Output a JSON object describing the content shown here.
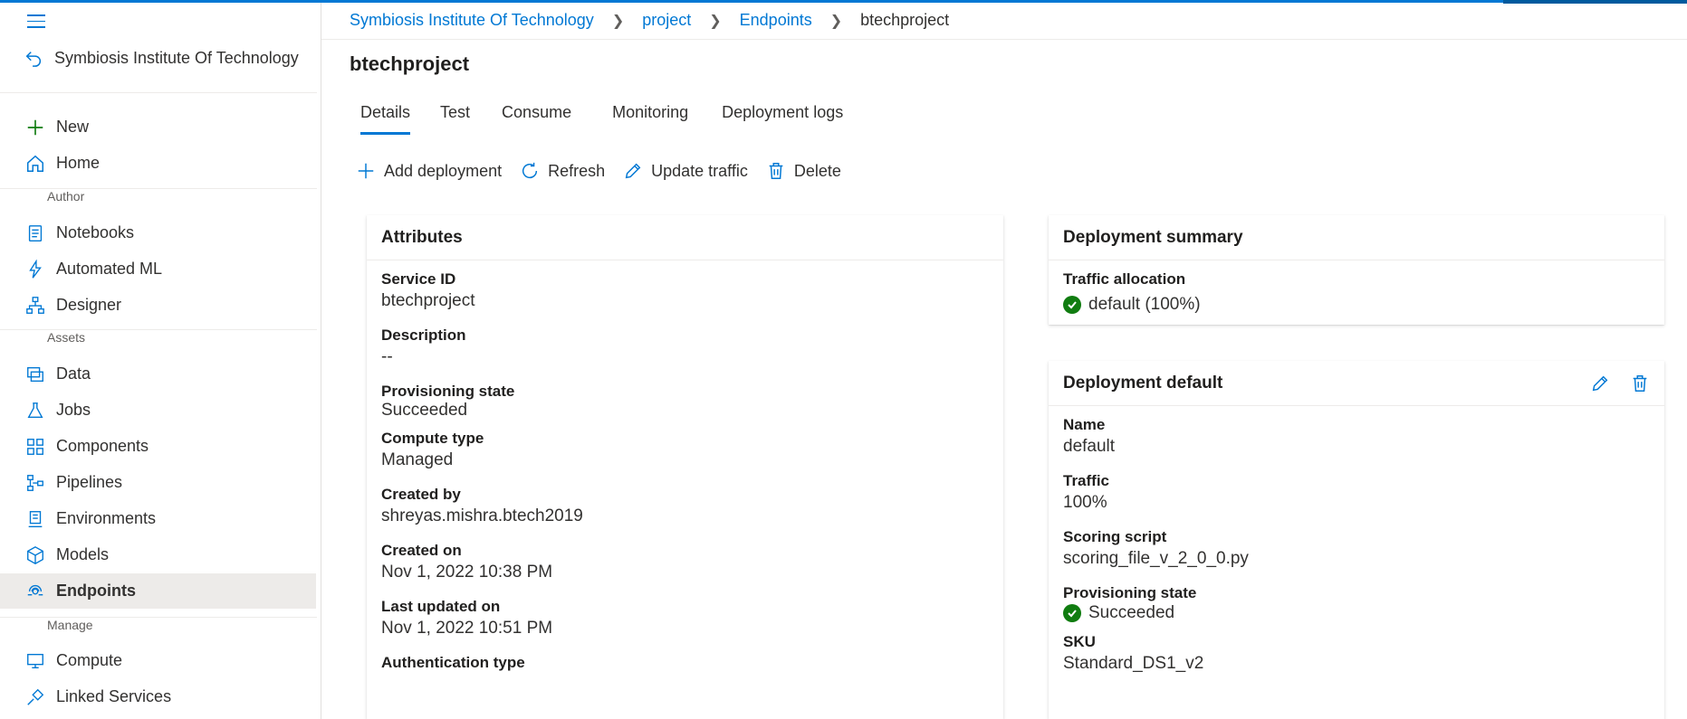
{
  "colors": {
    "accent": "#0078d4",
    "success": "#107c10",
    "active_bg": "#edebe9"
  },
  "workspace": {
    "name": "Symbiosis Institute Of Technology"
  },
  "sidebar": {
    "new_label": "New",
    "home_label": "Home",
    "sections": {
      "author": "Author",
      "assets": "Assets",
      "manage": "Manage"
    },
    "author_items": [
      {
        "label": "Notebooks",
        "icon": "notebook-icon"
      },
      {
        "label": "Automated ML",
        "icon": "automl-icon"
      },
      {
        "label": "Designer",
        "icon": "designer-icon"
      }
    ],
    "asset_items": [
      {
        "label": "Data",
        "icon": "data-icon"
      },
      {
        "label": "Jobs",
        "icon": "flask-icon"
      },
      {
        "label": "Components",
        "icon": "components-icon"
      },
      {
        "label": "Pipelines",
        "icon": "pipeline-icon"
      },
      {
        "label": "Environments",
        "icon": "environment-icon"
      },
      {
        "label": "Models",
        "icon": "cube-icon"
      },
      {
        "label": "Endpoints",
        "icon": "endpoint-icon",
        "active": true
      }
    ],
    "manage_items": [
      {
        "label": "Compute",
        "icon": "monitor-icon"
      },
      {
        "label": "Linked Services",
        "icon": "link-icon"
      }
    ]
  },
  "breadcrumb": {
    "items": [
      "Symbiosis Institute Of Technology",
      "project",
      "Endpoints"
    ],
    "current": "btechproject"
  },
  "page": {
    "title": "btechproject"
  },
  "tabs": [
    "Details",
    "Test",
    "Consume",
    "Monitoring",
    "Deployment logs"
  ],
  "active_tab": "Details",
  "toolbar": {
    "add": "Add deployment",
    "refresh": "Refresh",
    "update_traffic": "Update traffic",
    "delete": "Delete"
  },
  "attributes": {
    "title": "Attributes",
    "fields": [
      {
        "label": "Service ID",
        "value": "btechproject"
      },
      {
        "label": "Description",
        "value": "--"
      },
      {
        "label": "Provisioning state",
        "value": "Succeeded"
      },
      {
        "label": "Compute type",
        "value": "Managed"
      },
      {
        "label": "Created by",
        "value": "shreyas.mishra.btech2019"
      },
      {
        "label": "Created on",
        "value": "Nov 1, 2022 10:38 PM"
      },
      {
        "label": "Last updated on",
        "value": "Nov 1, 2022 10:51 PM"
      },
      {
        "label": "Authentication type",
        "value": ""
      }
    ]
  },
  "summary": {
    "title": "Deployment summary",
    "traffic_label": "Traffic allocation",
    "traffic_value": "default (100%)"
  },
  "deployment": {
    "title": "Deployment default",
    "fields": [
      {
        "label": "Name",
        "value": "default"
      },
      {
        "label": "Traffic",
        "value": "100%"
      },
      {
        "label": "Scoring script",
        "value": "scoring_file_v_2_0_0.py"
      },
      {
        "label": "Provisioning state",
        "value": "Succeeded"
      },
      {
        "label": "SKU",
        "value": "Standard_DS1_v2"
      }
    ]
  }
}
